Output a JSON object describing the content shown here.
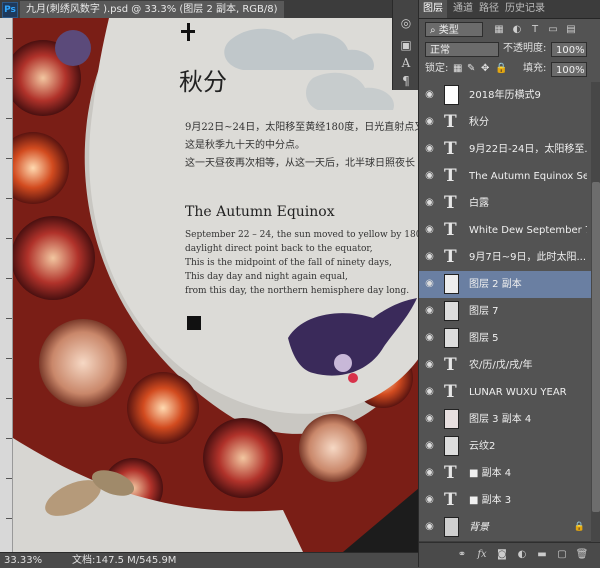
{
  "document": {
    "tab_title": "九月(刺绣风数字 ).psd @ 33.3% (图层 2 副本, RGB/8)",
    "zoom": "33.33%",
    "doc_size": "文档:147.5 M/545.9M"
  },
  "canvas": {
    "title_cn": "秋分",
    "cn_lines": [
      "9月22日~24日，太阳移至黄经180度，日光直射点又",
      "这是秋季九十天的中分点。",
      "这一天昼夜再次相等，从这一天后，北半球日照夜长"
    ],
    "title_en": "The Autumn Equinox",
    "en_lines": [
      "September 22 – 24, the sun moved to yellow by 180 degr",
      "daylight direct point back to the equator,",
      "This is the midpoint of the fall of ninety days,",
      "This day day and night again equal,",
      "from this day, the northern hemisphere day long."
    ]
  },
  "tools": [
    "brush-settings-icon",
    "clone-source-icon",
    "character-icon",
    "paragraph-icon"
  ],
  "panel": {
    "tabs": [
      "图层",
      "通道",
      "路径",
      "历史记录"
    ],
    "filter_kind": "类型",
    "blend_mode": "正常",
    "opacity_label": "不透明度:",
    "opacity_value": "100%",
    "lock_label": "锁定:",
    "fill_label": "填充:",
    "fill_value": "100%",
    "layers": [
      {
        "name": "2018年历横式9",
        "kind": "smart",
        "selected": false
      },
      {
        "name": "秋分",
        "kind": "text",
        "selected": false
      },
      {
        "name": "9月22日-24日，太阳移至...",
        "kind": "text",
        "selected": false
      },
      {
        "name": "The Autumn Equinox Septe...",
        "kind": "text",
        "selected": false
      },
      {
        "name": "白露",
        "kind": "text",
        "selected": false
      },
      {
        "name": "White Dew September 7 to ...",
        "kind": "text",
        "selected": false
      },
      {
        "name": "9月7日~9日，此时太阳...",
        "kind": "text",
        "selected": false
      },
      {
        "name": "图层 2 副本",
        "kind": "image",
        "selected": true
      },
      {
        "name": "图层 7",
        "kind": "image",
        "selected": false
      },
      {
        "name": "图层 5",
        "kind": "image",
        "selected": false
      },
      {
        "name": "农/历/戊/戌/年",
        "kind": "text",
        "selected": false
      },
      {
        "name": "LUNAR WUXU YEAR",
        "kind": "text",
        "selected": false
      },
      {
        "name": "图层 3 副本 4",
        "kind": "image",
        "selected": false
      },
      {
        "name": "云纹2",
        "kind": "image",
        "selected": false
      },
      {
        "name": "■ 副本 4",
        "kind": "text",
        "selected": false
      },
      {
        "name": "■ 副本 3",
        "kind": "text",
        "selected": false
      },
      {
        "name": "背景",
        "kind": "background",
        "selected": false
      }
    ]
  }
}
